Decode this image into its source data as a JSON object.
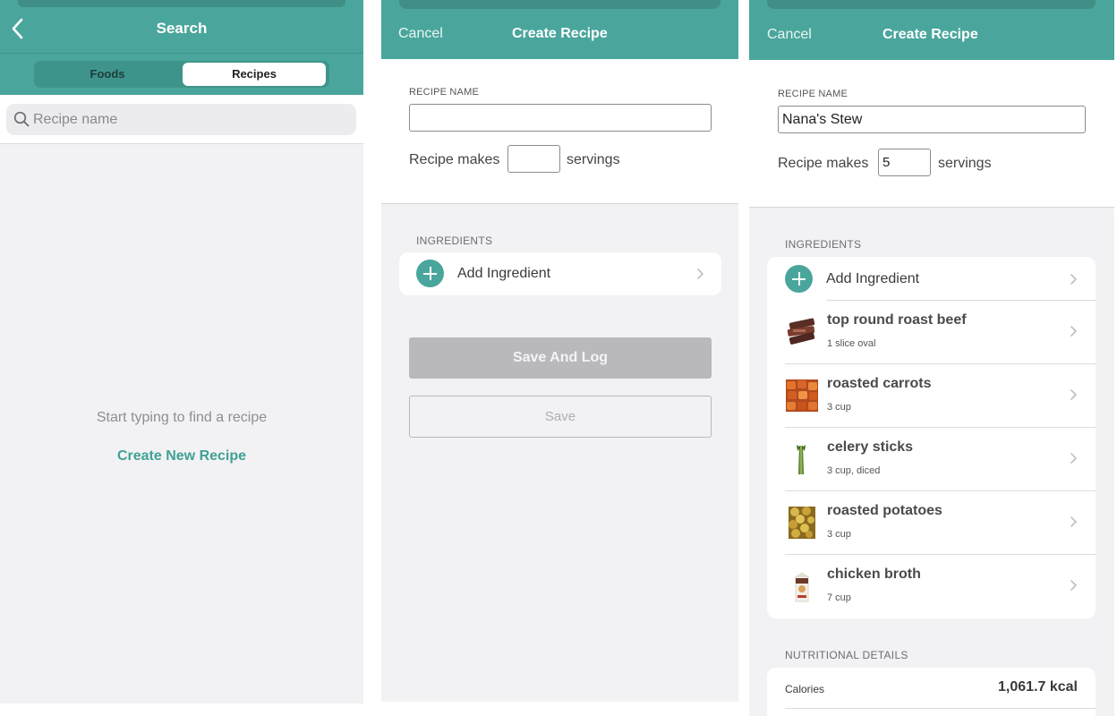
{
  "search_screen": {
    "title": "Search",
    "tabs": {
      "foods": "Foods",
      "recipes": "Recipes"
    },
    "search_placeholder": "Recipe name",
    "empty_message": "Start typing to find a recipe",
    "create_link": "Create New Recipe"
  },
  "create_empty": {
    "cancel": "Cancel",
    "title": "Create Recipe",
    "recipe_name_label": "RECIPE NAME",
    "recipe_name_value": "",
    "makes_label": "Recipe makes",
    "servings_value": "",
    "servings_label": "servings",
    "ingredients_label": "INGREDIENTS",
    "add_ingredient": "Add Ingredient",
    "save_and_log": "Save And Log",
    "save": "Save"
  },
  "create_filled": {
    "cancel": "Cancel",
    "title": "Create Recipe",
    "recipe_name_label": "RECIPE NAME",
    "recipe_name_value": "Nana's Stew",
    "makes_label": "Recipe makes",
    "servings_value": "5",
    "servings_label": "servings",
    "ingredients_label": "INGREDIENTS",
    "add_ingredient": "Add Ingredient",
    "ingredients": [
      {
        "name": "top round roast beef",
        "amount": "1 slice oval",
        "icon": "beef-icon"
      },
      {
        "name": "roasted carrots",
        "amount": "3 cup",
        "icon": "carrots-icon"
      },
      {
        "name": "celery sticks",
        "amount": "3 cup, diced",
        "icon": "celery-icon"
      },
      {
        "name": "roasted potatoes",
        "amount": "3 cup",
        "icon": "potatoes-icon"
      },
      {
        "name": "chicken broth",
        "amount": "7 cup",
        "icon": "broth-carton-icon"
      }
    ],
    "nutrition_label": "NUTRITIONAL DETAILS",
    "nutrition": [
      {
        "label": "Calories",
        "value": "1,061.7 kcal"
      }
    ]
  },
  "colors": {
    "header_teal": "#4aa69c",
    "accent_link": "#3fa194",
    "disabled_button": "#b9b9bc",
    "background": "#f2f2f4"
  }
}
